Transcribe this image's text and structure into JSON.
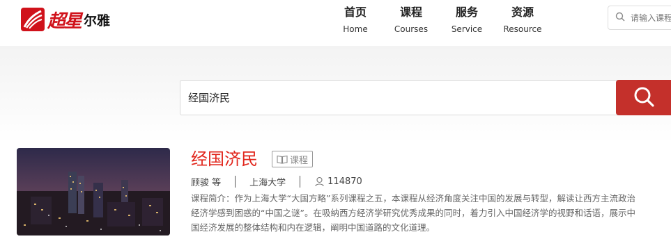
{
  "header": {
    "logo_script": "超星",
    "logo_name": "尔雅",
    "nav": [
      {
        "zh": "首页",
        "en": "Home"
      },
      {
        "zh": "课程",
        "en": "Courses"
      },
      {
        "zh": "服务",
        "en": "Service"
      },
      {
        "zh": "资源",
        "en": "Resource"
      }
    ],
    "search_placeholder": "请输入课程"
  },
  "search": {
    "value": "经国济民"
  },
  "result": {
    "title": "经国济民",
    "tag": "课程",
    "teacher": "顾骏 等",
    "school": "上海大学",
    "count": "114870",
    "description": "课程简介：作为上海大学“大国方略”系列课程之五，本课程从经济角度关注中国的发展与转型，解读让西方主流政治经济学感到困惑的“中国之谜”。在吸纳西方经济学研究优秀成果的同时，着力引入中国经济学的视野和话语，展示中国经济发展的整体结构和内在逻辑，阐明中国道路的文化道理。"
  },
  "colors": {
    "accent": "#e1251b",
    "search_button": "#c4302b"
  }
}
